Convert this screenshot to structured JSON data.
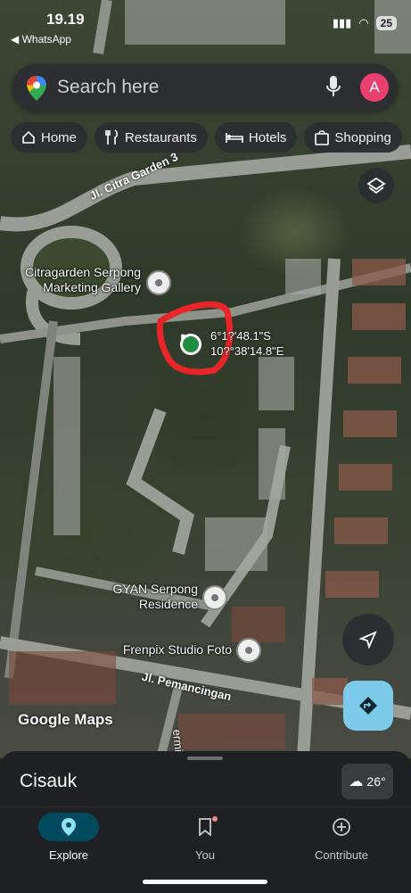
{
  "status": {
    "time": "19.19",
    "back_app": "◀ WhatsApp",
    "battery": "25"
  },
  "search": {
    "placeholder": "Search here",
    "avatar_letter": "A"
  },
  "chips": [
    {
      "label": "Home",
      "icon": "home-icon"
    },
    {
      "label": "Restaurants",
      "icon": "fork-knife-icon"
    },
    {
      "label": "Hotels",
      "icon": "bed-icon"
    },
    {
      "label": "Shopping",
      "icon": "shopping-bag-icon"
    }
  ],
  "map": {
    "places": [
      {
        "name_line1": "Citragarden Serpong",
        "name_line2": "Marketing Gallery"
      },
      {
        "name_line1": "GYAN Serpong",
        "name_line2": "Residence"
      },
      {
        "name_line1": "Frenpix Studio Foto",
        "name_line2": ""
      }
    ],
    "roads": [
      "Jl. Citra Garden 3",
      "Jl. Pemancingan",
      "ermis"
    ],
    "dropped_pin": {
      "lat": "6°1?'48.1\"S",
      "lng": "10?°38'14.8\"E"
    },
    "attribution": "Google Maps"
  },
  "sheet": {
    "title": "Cisauk",
    "temperature": "26°"
  },
  "bottom_nav": [
    {
      "label": "Explore",
      "active": true
    },
    {
      "label": "You",
      "active": false
    },
    {
      "label": "Contribute",
      "active": false
    }
  ],
  "colors": {
    "accent_red": "#e8262a",
    "avatar": "#e8416f",
    "direction_button": "#7ccbea",
    "nav_active": "#004a5e"
  }
}
